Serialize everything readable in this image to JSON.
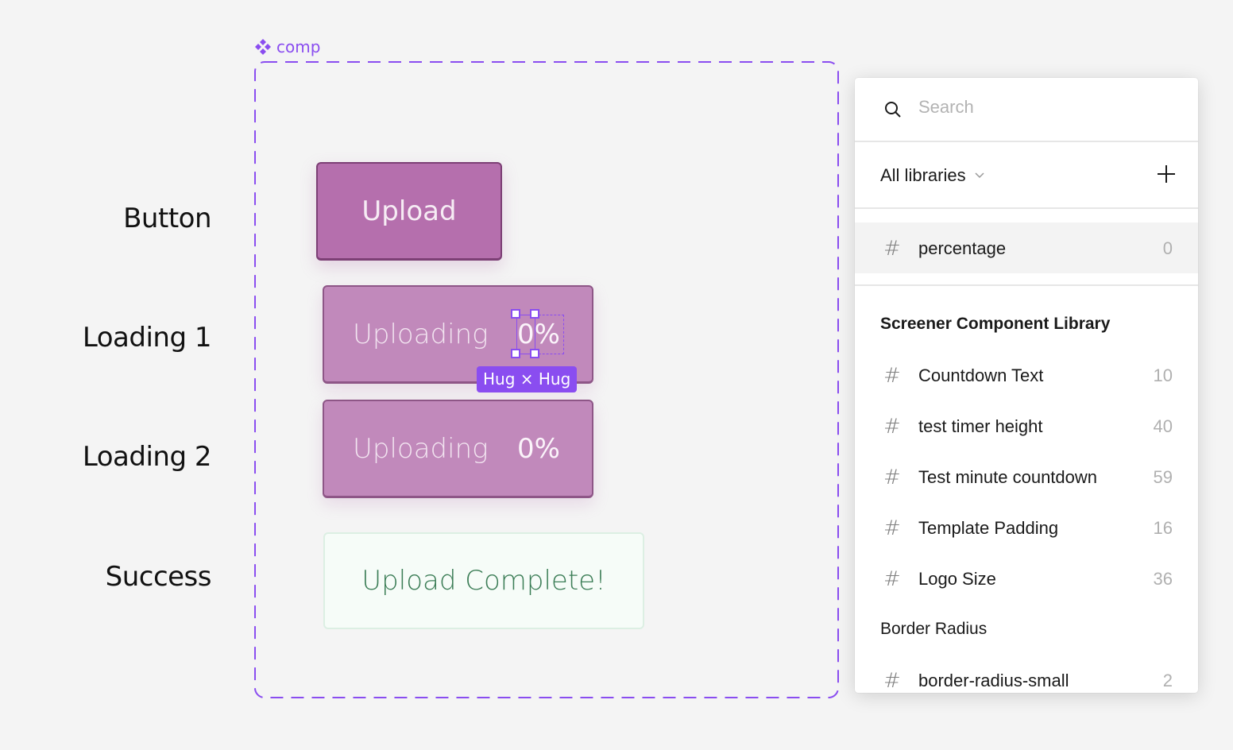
{
  "canvas": {
    "component_name": "comp",
    "accent_color": "#8a4df0",
    "row_labels": [
      "Button",
      "Loading 1",
      "Loading 2",
      "Success"
    ],
    "buttons": {
      "upload": {
        "label": "Upload"
      },
      "loading_1": {
        "label": "Uploading",
        "percentage": "0%"
      },
      "loading_2": {
        "label": "Uploading",
        "percentage": "0%"
      },
      "success": {
        "label": "Upload Complete!"
      }
    },
    "selection_badge": "Hug × Hug"
  },
  "library_panel": {
    "search_placeholder": "Search",
    "search_value": "",
    "library_filter": "All libraries",
    "local_variables": [
      {
        "name": "percentage",
        "value": "0"
      }
    ],
    "groups": [
      {
        "title": "Screener Component Library",
        "items": [
          {
            "name": "Countdown Text",
            "value": "10"
          },
          {
            "name": "test timer height",
            "value": "40"
          },
          {
            "name": "Test minute countdown",
            "value": "59"
          },
          {
            "name": "Template Padding",
            "value": "16"
          },
          {
            "name": "Logo Size",
            "value": "36"
          }
        ]
      },
      {
        "title": "Border Radius",
        "items": [
          {
            "name": "border-radius-small",
            "value": "2"
          }
        ]
      }
    ]
  }
}
